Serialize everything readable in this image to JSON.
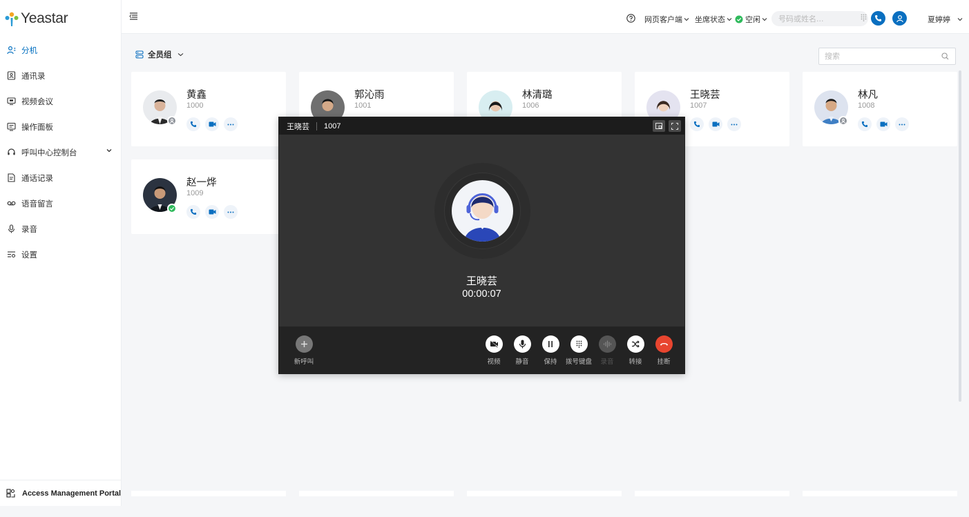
{
  "app": {
    "name": "Yeastar"
  },
  "sidebar": {
    "items": [
      {
        "label": "分机",
        "icon": "extension-icon",
        "active": true
      },
      {
        "label": "通讯录",
        "icon": "contacts-icon"
      },
      {
        "label": "视频会议",
        "icon": "video-conference-icon"
      },
      {
        "label": "操作面板",
        "icon": "operator-panel-icon"
      },
      {
        "label": "呼叫中心控制台",
        "icon": "headset-icon"
      },
      {
        "label": "通话记录",
        "icon": "call-log-icon"
      },
      {
        "label": "语音留言",
        "icon": "voicemail-icon"
      },
      {
        "label": "录音",
        "icon": "microphone-icon"
      },
      {
        "label": "设置",
        "icon": "settings-icon"
      }
    ],
    "footer": "Access Management Portal"
  },
  "header": {
    "web_client": "网页客户端",
    "agent_status": "坐席状态",
    "presence": "空闲",
    "search_placeholder": "号码或姓名...",
    "user_name": "夏婷婷"
  },
  "content": {
    "group": "全员组",
    "search_placeholder": "搜索"
  },
  "extensions": [
    {
      "name": "黄鑫",
      "ext": "1000",
      "status": "offline"
    },
    {
      "name": "郭沁雨",
      "ext": "1001",
      "status": "offline"
    },
    {
      "name": "林清璐",
      "ext": "1006",
      "status": "offline"
    },
    {
      "name": "王晓芸",
      "ext": "1007",
      "status": "offline"
    },
    {
      "name": "林凡",
      "ext": "1008",
      "status": "offline"
    },
    {
      "name": "赵一烨",
      "ext": "1009",
      "status": "online"
    }
  ],
  "call": {
    "name": "王晓芸",
    "ext": "1007",
    "timer": "00:00:07",
    "controls": {
      "new_call": "新呼叫",
      "video": "视频",
      "mute": "静音",
      "hold": "保持",
      "keypad": "拨号键盘",
      "record": "录音",
      "transfer": "转接",
      "hangup": "挂断"
    }
  },
  "colors": {
    "accent": "#0a6fc0",
    "online": "#2fba5c",
    "hangup": "#e8452f"
  }
}
